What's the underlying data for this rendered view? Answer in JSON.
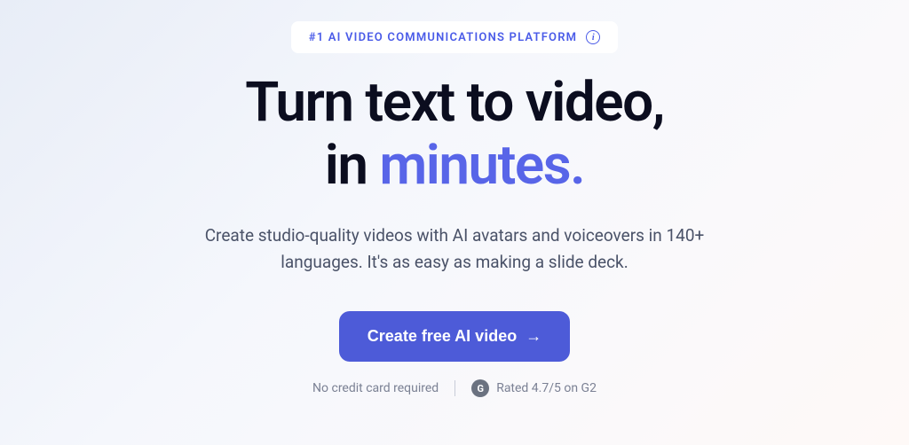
{
  "badge": {
    "text": "#1 AI VIDEO COMMUNICATIONS PLATFORM"
  },
  "headline": {
    "line1": "Turn text to video,",
    "line2_prefix": "in ",
    "line2_accent": "minutes."
  },
  "subheadline": "Create studio-quality videos with AI avatars and voiceovers in 140+ languages. It's as easy as making a slide deck.",
  "cta": {
    "label": "Create free AI video"
  },
  "footer": {
    "no_card": "No credit card required",
    "rating": "Rated 4.7/5 on G2",
    "g2_symbol": "G"
  }
}
